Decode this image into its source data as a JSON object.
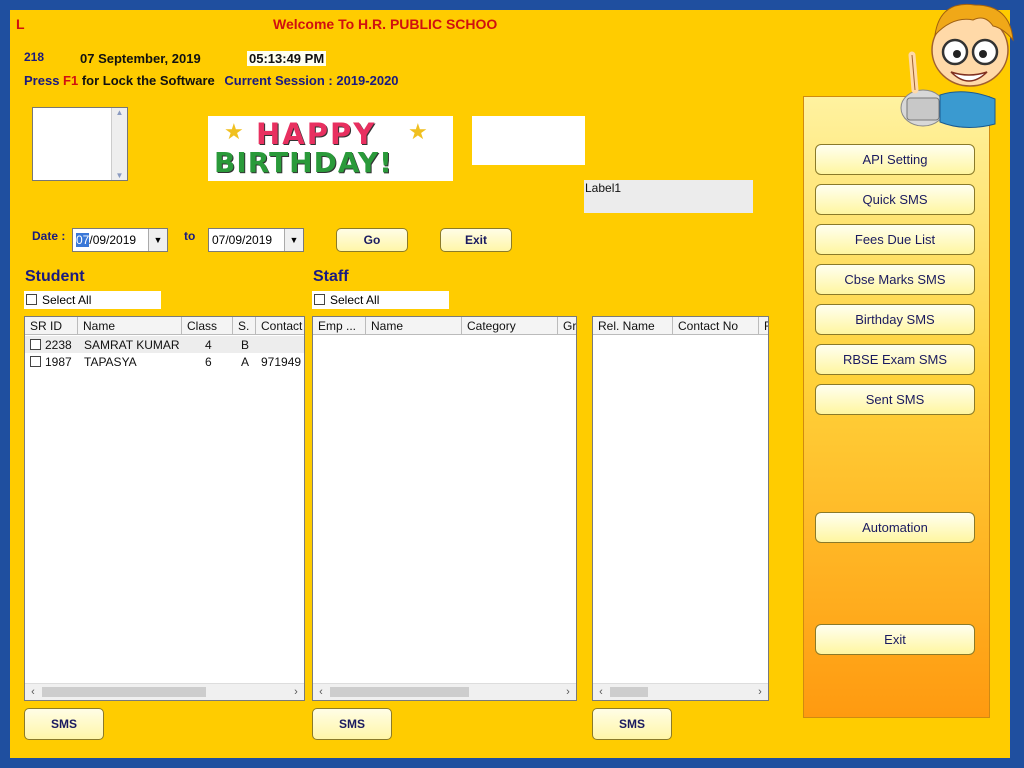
{
  "header": {
    "left_letter": "L",
    "welcome": "Welcome To  H.R. PUBLIC SCHOO",
    "user_id": "218",
    "date": "07 September, 2019",
    "time": "05:13:49 PM",
    "press": "Press",
    "key": "F1",
    "lock_text": "for Lock the Software",
    "session": "Current Session : 2019-2020"
  },
  "banner": {
    "line1": "HAPPY",
    "line2": "BIRTHDAY!"
  },
  "label1": "Label1",
  "filter": {
    "date_label": "Date :",
    "from_value": "07/09/2019",
    "to_label": "to",
    "to_value": "07/09/2019",
    "go_label": "Go",
    "exit_label": "Exit"
  },
  "student": {
    "title": "Student",
    "select_all": "Select All",
    "columns": [
      "SR ID",
      "Name",
      "Class",
      "S.",
      "Contact"
    ],
    "rows": [
      {
        "id": "2238",
        "name": "SAMRAT KUMAR",
        "class": "4",
        "section": "B",
        "contact": ""
      },
      {
        "id": "1987",
        "name": "TAPASYA",
        "class": "6",
        "section": "A",
        "contact": "971949"
      }
    ],
    "sms_label": "SMS"
  },
  "staff": {
    "title": "Staff",
    "select_all": "Select All",
    "columns": [
      "Emp ...",
      "Name",
      "Category",
      "Gr"
    ],
    "sms_label": "SMS"
  },
  "relatives": {
    "columns": [
      "Rel. Name",
      "Contact No",
      "R"
    ],
    "sms_label": "SMS"
  },
  "menu": {
    "api_setting": "API Setting",
    "quick_sms": "Quick SMS",
    "fees_due_list": "Fees Due List",
    "cbse_marks_sms": "Cbse Marks SMS",
    "birthday_sms": "Birthday SMS",
    "rbse_exam_sms": "RBSE Exam SMS",
    "sent_sms": "Sent SMS",
    "automation": "Automation",
    "exit": "Exit"
  },
  "colors": {
    "frame": "#ffcc00",
    "border": "#1f4f9f",
    "title_red": "#d01010",
    "navy": "#1a1a80"
  }
}
